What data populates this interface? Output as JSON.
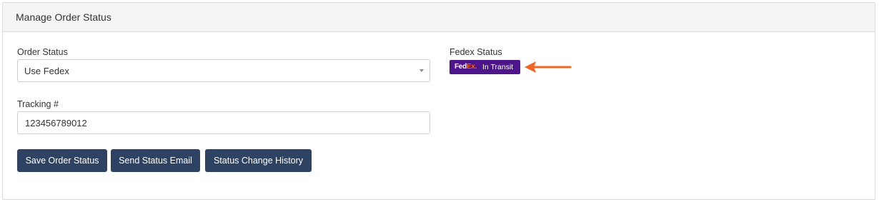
{
  "panel": {
    "title": "Manage Order Status"
  },
  "order_status": {
    "label": "Order Status",
    "selected": "Use Fedex"
  },
  "tracking": {
    "label": "Tracking #",
    "value": "123456789012"
  },
  "buttons": {
    "save": "Save Order Status",
    "send_email": "Send Status Email",
    "history": "Status Change History"
  },
  "fedex_status": {
    "label": "Fedex Status",
    "logo_fed": "Fed",
    "logo_ex": "Ex.",
    "status": "In Transit",
    "badge_color": "#4d148c"
  },
  "colors": {
    "button": "#2e4363",
    "arrow": "#f26522",
    "fedex_orange": "#ff6200"
  },
  "icons": {
    "dropdown": "chevron-down-icon",
    "annotation": "arrow-left-icon"
  }
}
